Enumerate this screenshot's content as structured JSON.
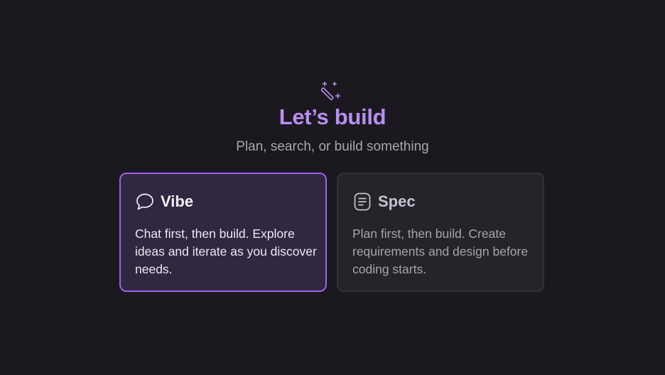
{
  "hero": {
    "icon": "magic-wand-icon",
    "title": "Let’s build",
    "subtitle": "Plan, search, or build something"
  },
  "modes": {
    "vibe": {
      "icon": "chat-bubble-icon",
      "title": "Vibe",
      "description": "Chat first, then build. Explore ideas and iterate as you discover needs.",
      "selected": true
    },
    "spec": {
      "icon": "document-lines-icon",
      "title": "Spec",
      "description": "Plan first, then build. Create requirements and design before coding starts.",
      "selected": false
    }
  },
  "colors": {
    "background": "#1c181f",
    "accent": "#b88ff0",
    "selected_border": "#9a63ea",
    "selected_card": "#322741",
    "card": "#26232a"
  }
}
